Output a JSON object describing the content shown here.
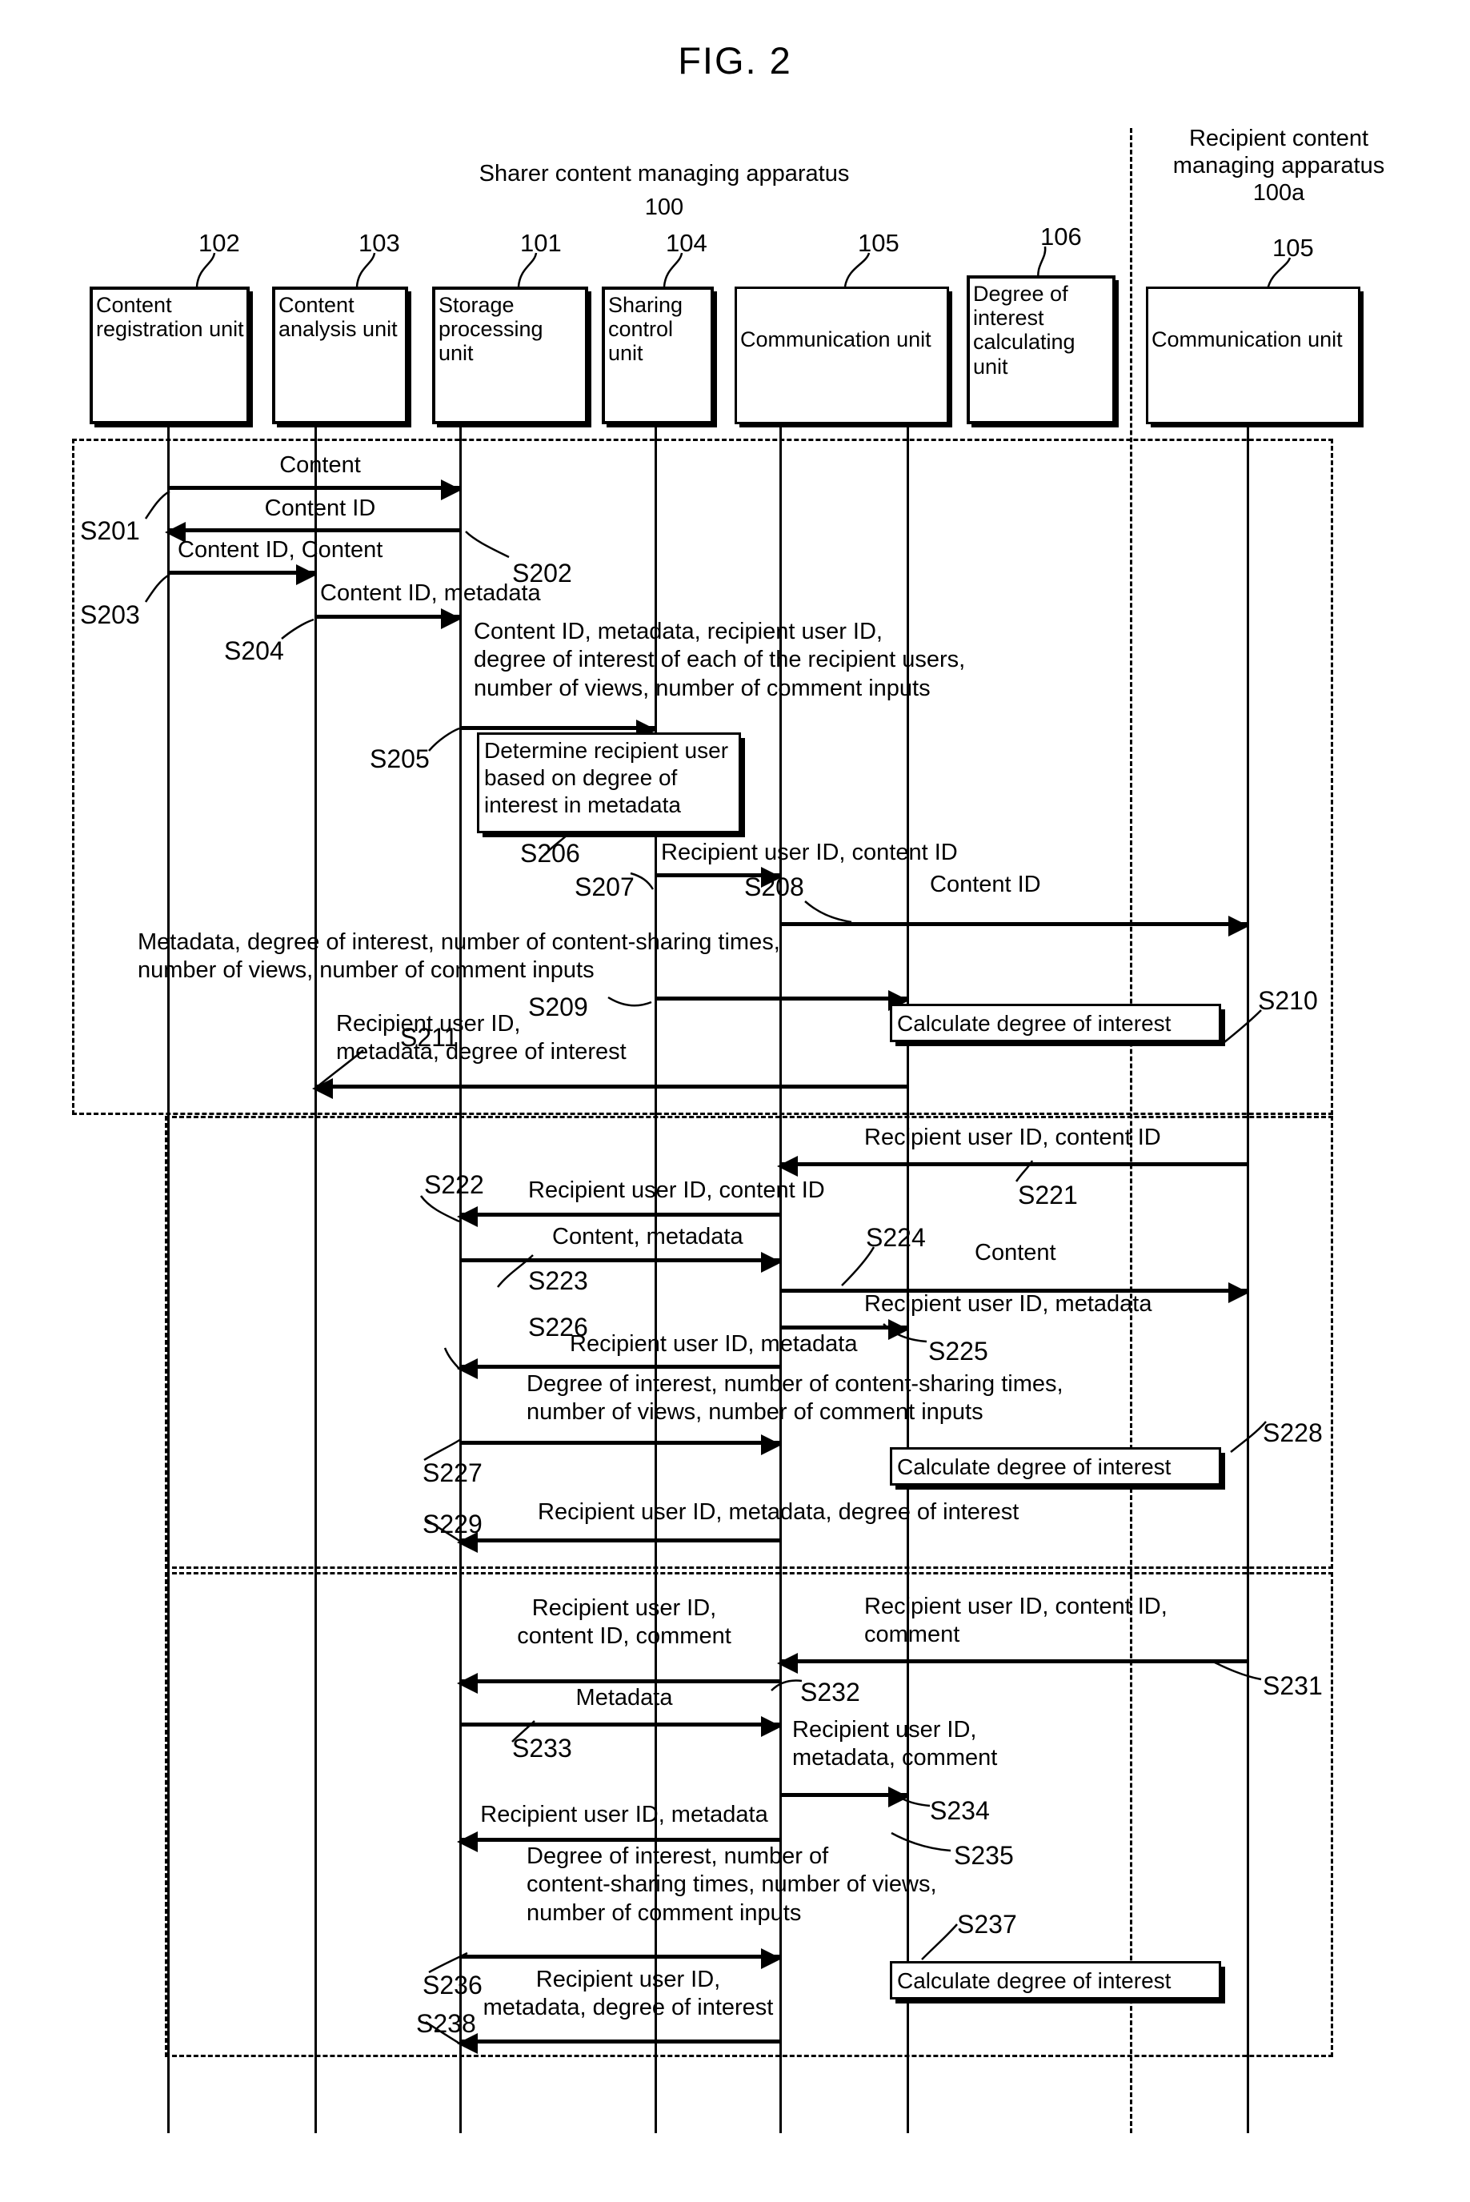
{
  "figure": {
    "title": "FIG. 2"
  },
  "groups": [
    {
      "name": "sharer-apparatus",
      "title": "Sharer content managing apparatus",
      "ref": "100"
    },
    {
      "name": "recipient-apparatus",
      "title": "Recipient content\nmanaging apparatus",
      "ref": "100a"
    }
  ],
  "group_labels": {
    "sharer_line1": "Sharer content managing apparatus",
    "sharer_ref": "100",
    "recipient_line1": "Recipient content",
    "recipient_line2": "managing apparatus",
    "recipient_ref": "100a"
  },
  "units": [
    {
      "name": "content-registration-unit",
      "label": "Content registration unit",
      "ref": "102"
    },
    {
      "name": "content-analysis-unit",
      "label": "Content analysis unit",
      "ref": "103"
    },
    {
      "name": "storage-processing-unit",
      "label": "Storage processing unit",
      "ref": "101"
    },
    {
      "name": "sharing-control-unit",
      "label": "Sharing control unit",
      "ref": "104"
    },
    {
      "name": "communication-unit-sharer",
      "label": "Communication unit",
      "ref": "105"
    },
    {
      "name": "degree-of-interest-calculating-unit",
      "label": "Degree of interest calculating unit",
      "ref": "106"
    },
    {
      "name": "communication-unit-recipient",
      "label": "Communication unit",
      "ref": "105"
    }
  ],
  "messages": {
    "m201": "Content",
    "m202": "Content ID",
    "m203": "Content ID, Content",
    "m204": "Content ID, metadata",
    "m205_l1": "Content ID, metadata, recipient user ID,",
    "m205_l2": "degree of interest of each of the recipient users,",
    "m205_l3": "number of views, number of comment inputs",
    "m206_l1": "Determine recipient user",
    "m206_l2": "based on degree of",
    "m206_l3": "interest in metadata",
    "m207": "Recipient user ID, content ID",
    "m208": "Content ID",
    "m209_l1": "Metadata, degree of interest, number of content-sharing times,",
    "m209_l2": "number of views, number of comment inputs",
    "m210": "Calculate degree of interest",
    "m211_l1": "Recipient user ID,",
    "m211_l2": "metadata, degree of interest",
    "m221": "Recipient user ID, content ID",
    "m222": "Recipient user ID, content ID",
    "m223": "Content, metadata",
    "m224": "Content",
    "m225": "Recipient user ID, metadata",
    "m226": "Recipient user ID, metadata",
    "m227_l1": "Degree of interest, number of content-sharing times,",
    "m227_l2": "number of views, number of comment inputs",
    "m228": "Calculate degree of interest",
    "m229": "Recipient user ID, metadata, degree of interest",
    "m231_l1": "Recipient user ID, content ID,",
    "m231_l2": "comment",
    "m232_l1": "Recipient user ID,",
    "m232_l2": "content ID, comment",
    "m233": "Metadata",
    "m234_l1": "Recipient user ID,",
    "m234_l2": "metadata, comment",
    "m235": "Recipient user ID, metadata",
    "m236_l1": "Degree of interest, number of",
    "m236_l2": "content-sharing times, number of views,",
    "m236_l3": "number of comment inputs",
    "m237": "Calculate degree of interest",
    "m238_l1": "Recipient user ID,",
    "m238_l2": "metadata, degree of interest"
  },
  "steps": {
    "s201": "S201",
    "s202": "S202",
    "s203": "S203",
    "s204": "S204",
    "s205": "S205",
    "s206": "S206",
    "s207": "S207",
    "s208": "S208",
    "s209": "S209",
    "s210": "S210",
    "s211": "S211",
    "s221": "S221",
    "s222": "S222",
    "s223": "S223",
    "s224": "S224",
    "s225": "S225",
    "s226": "S226",
    "s227": "S227",
    "s228": "S228",
    "s229": "S229",
    "s231": "S231",
    "s232": "S232",
    "s233": "S233",
    "s234": "S234",
    "s235": "S235",
    "s236": "S236",
    "s237": "S237",
    "s238": "S238"
  },
  "colors": {
    "ink": "#000000",
    "paper": "#ffffff"
  }
}
